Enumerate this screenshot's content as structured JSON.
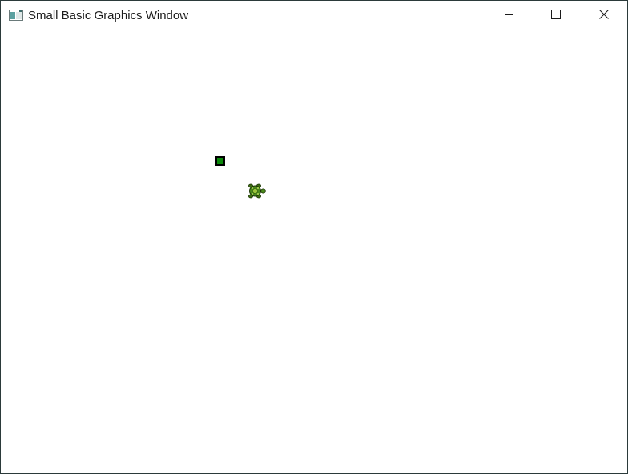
{
  "window": {
    "title": "Small Basic Graphics Window",
    "icon": "small-basic-app-icon"
  },
  "caption_buttons": {
    "minimize_icon": "minimize-icon",
    "maximize_icon": "maximize-icon",
    "close_icon": "close-icon"
  },
  "canvas": {
    "background": "#ffffff",
    "shapes": [
      {
        "kind": "rectangle",
        "fill": "#0b8a0b",
        "stroke": "#000000"
      },
      {
        "kind": "turtle",
        "fill": "#4a8a1c"
      }
    ]
  }
}
